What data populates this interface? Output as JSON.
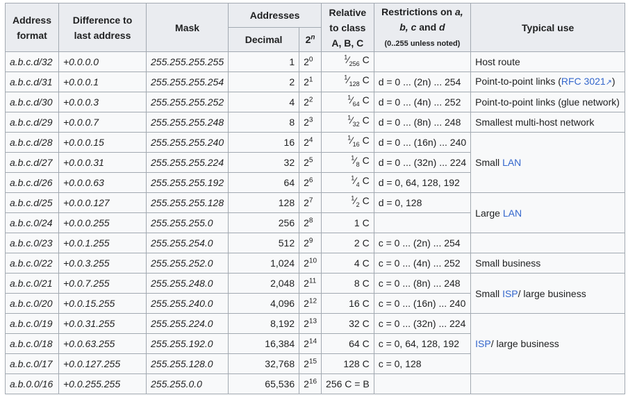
{
  "headers": {
    "address_format": "Address format",
    "difference": "Difference to last address",
    "mask": "Mask",
    "addresses": "Addresses",
    "decimal": "Decimal",
    "pow_base": "2",
    "pow_exp": "n",
    "relative": "Relative to class A, B, C",
    "restrictions_pre": "Restrictions on ",
    "restrictions_vars": "a, b, c",
    "restrictions_and": " and ",
    "restrictions_d": "d",
    "restrictions_note": "(0..255 unless noted)",
    "typical_use": "Typical use"
  },
  "rows": [
    {
      "format": "a.b.c.d/32",
      "diff": "+0.0.0.0",
      "mask": "255.255.255.255",
      "decimal": "1",
      "exp": "0",
      "rel_num": "1",
      "rel_den": "256",
      "rel_cls": "C",
      "restr": ""
    },
    {
      "format": "a.b.c.d/31",
      "diff": "+0.0.0.1",
      "mask": "255.255.255.254",
      "decimal": "2",
      "exp": "1",
      "rel_num": "1",
      "rel_den": "128",
      "rel_cls": "C",
      "restr": "d = 0 ... (2n) ... 254"
    },
    {
      "format": "a.b.c.d/30",
      "diff": "+0.0.0.3",
      "mask": "255.255.255.252",
      "decimal": "4",
      "exp": "2",
      "rel_num": "1",
      "rel_den": "64",
      "rel_cls": "C",
      "restr": "d = 0 ... (4n) ... 252"
    },
    {
      "format": "a.b.c.d/29",
      "diff": "+0.0.0.7",
      "mask": "255.255.255.248",
      "decimal": "8",
      "exp": "3",
      "rel_num": "1",
      "rel_den": "32",
      "rel_cls": "C",
      "restr": "d = 0 ... (8n) ... 248"
    },
    {
      "format": "a.b.c.d/28",
      "diff": "+0.0.0.15",
      "mask": "255.255.255.240",
      "decimal": "16",
      "exp": "4",
      "rel_num": "1",
      "rel_den": "16",
      "rel_cls": "C",
      "restr": "d = 0 ... (16n) ... 240"
    },
    {
      "format": "a.b.c.d/27",
      "diff": "+0.0.0.31",
      "mask": "255.255.255.224",
      "decimal": "32",
      "exp": "5",
      "rel_num": "1",
      "rel_den": "8",
      "rel_cls": "C",
      "restr": "d = 0 ... (32n) ... 224"
    },
    {
      "format": "a.b.c.d/26",
      "diff": "+0.0.0.63",
      "mask": "255.255.255.192",
      "decimal": "64",
      "exp": "6",
      "rel_num": "1",
      "rel_den": "4",
      "rel_cls": "C",
      "restr": "d = 0, 64, 128, 192"
    },
    {
      "format": "a.b.c.d/25",
      "diff": "+0.0.0.127",
      "mask": "255.255.255.128",
      "decimal": "128",
      "exp": "7",
      "rel_num": "1",
      "rel_den": "2",
      "rel_cls": "C",
      "restr": "d = 0, 128"
    },
    {
      "format": "a.b.c.0/24",
      "diff": "+0.0.0.255",
      "mask": "255.255.255.0",
      "decimal": "256",
      "exp": "8",
      "rel_text": "1 C",
      "restr": ""
    },
    {
      "format": "a.b.c.0/23",
      "diff": "+0.0.1.255",
      "mask": "255.255.254.0",
      "decimal": "512",
      "exp": "9",
      "rel_text": "2 C",
      "restr": "c = 0 ... (2n) ... 254"
    },
    {
      "format": "a.b.c.0/22",
      "diff": "+0.0.3.255",
      "mask": "255.255.252.0",
      "decimal": "1,024",
      "exp": "10",
      "rel_text": "4 C",
      "restr": "c = 0 ... (4n) ... 252"
    },
    {
      "format": "a.b.c.0/21",
      "diff": "+0.0.7.255",
      "mask": "255.255.248.0",
      "decimal": "2,048",
      "exp": "11",
      "rel_text": "8 C",
      "restr": "c = 0 ... (8n) ... 248"
    },
    {
      "format": "a.b.c.0/20",
      "diff": "+0.0.15.255",
      "mask": "255.255.240.0",
      "decimal": "4,096",
      "exp": "12",
      "rel_text": "16 C",
      "restr": "c = 0 ... (16n) ... 240"
    },
    {
      "format": "a.b.c.0/19",
      "diff": "+0.0.31.255",
      "mask": "255.255.224.0",
      "decimal": "8,192",
      "exp": "13",
      "rel_text": "32 C",
      "restr": "c = 0 ... (32n) ... 224"
    },
    {
      "format": "a.b.c.0/18",
      "diff": "+0.0.63.255",
      "mask": "255.255.192.0",
      "decimal": "16,384",
      "exp": "14",
      "rel_text": "64 C",
      "restr": "c = 0, 64, 128, 192"
    },
    {
      "format": "a.b.c.0/17",
      "diff": "+0.0.127.255",
      "mask": "255.255.128.0",
      "decimal": "32,768",
      "exp": "15",
      "rel_text": "128 C",
      "restr": "c = 0, 128"
    },
    {
      "format": "a.b.0.0/16",
      "diff": "+0.0.255.255",
      "mask": "255.255.0.0",
      "decimal": "65,536",
      "exp": "16",
      "rel_text": "256 C = B",
      "restr": ""
    }
  ],
  "uses": {
    "host_route": "Host route",
    "p2p_pre": "Point-to-point links (",
    "p2p_link": "RFC 3021",
    "p2p_ext": "↗",
    "p2p_post": ")",
    "p2p_glue": "Point-to-point links (glue network)",
    "smallest": "Smallest multi-host network",
    "small_pre": "Small ",
    "lan": "LAN",
    "large_pre": "Large ",
    "small_business": "Small business",
    "small_isp_pre": "Small ",
    "isp": "ISP",
    "large_business": "/ large business"
  },
  "colors": {
    "header_bg": "#eaecf0",
    "cell_bg": "#f8f9fa",
    "border": "#a2a9b1",
    "link": "#3366cc"
  }
}
